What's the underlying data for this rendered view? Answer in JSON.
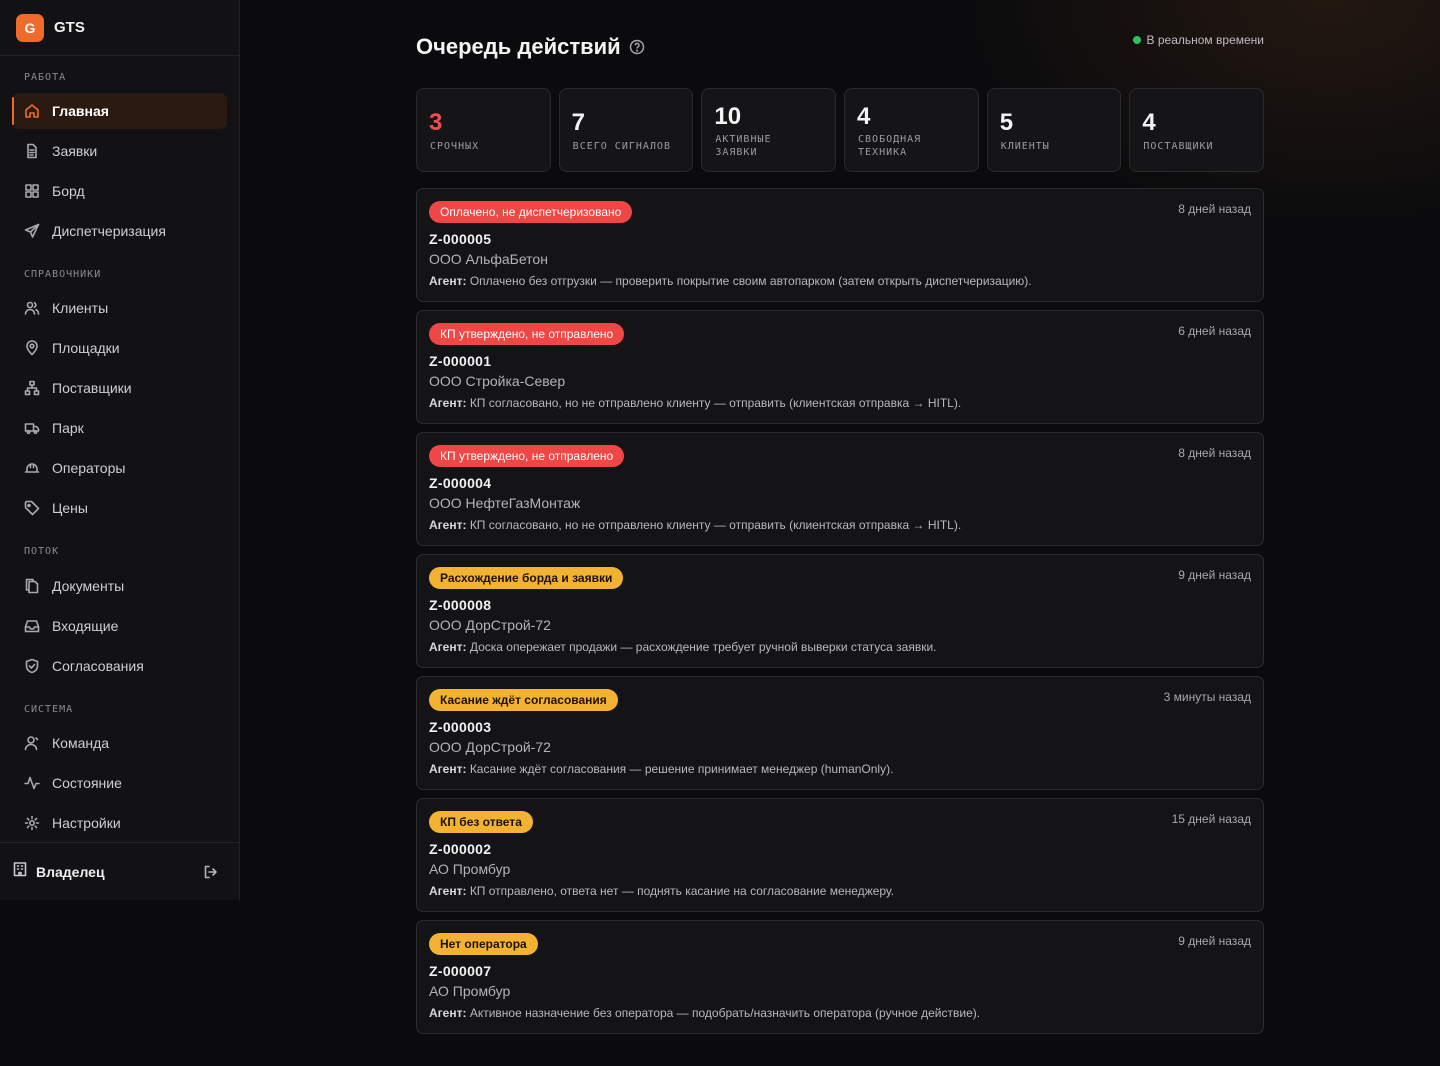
{
  "brand": {
    "logo_letter": "G",
    "name": "GTS"
  },
  "sidebar": {
    "sections": [
      {
        "title": "РАБОТА",
        "items": [
          {
            "label": "Главная",
            "icon": "home-icon",
            "active": true
          },
          {
            "label": "Заявки",
            "icon": "document-icon"
          },
          {
            "label": "Борд",
            "icon": "grid-icon"
          },
          {
            "label": "Диспетчеризация",
            "icon": "send-icon"
          }
        ]
      },
      {
        "title": "СПРАВОЧНИКИ",
        "items": [
          {
            "label": "Клиенты",
            "icon": "users-icon"
          },
          {
            "label": "Площадки",
            "icon": "map-pin-icon"
          },
          {
            "label": "Поставщики",
            "icon": "network-icon"
          },
          {
            "label": "Парк",
            "icon": "truck-icon"
          },
          {
            "label": "Операторы",
            "icon": "hard-hat-icon"
          },
          {
            "label": "Цены",
            "icon": "tag-icon"
          }
        ]
      },
      {
        "title": "ПОТОК",
        "items": [
          {
            "label": "Документы",
            "icon": "files-icon"
          },
          {
            "label": "Входящие",
            "icon": "inbox-icon"
          },
          {
            "label": "Согласования",
            "icon": "shield-check-icon"
          }
        ]
      },
      {
        "title": "СИСТЕМА",
        "items": [
          {
            "label": "Команда",
            "icon": "user-icon"
          },
          {
            "label": "Состояние",
            "icon": "activity-icon"
          },
          {
            "label": "Настройки",
            "icon": "gear-icon"
          }
        ]
      }
    ],
    "footer": {
      "user": "Владелец",
      "icon": "building-icon",
      "logout_icon": "logout-icon"
    }
  },
  "header": {
    "title": "Очередь действий",
    "live_label": "В реальном времени",
    "live_color": "#2fbf62"
  },
  "stats": [
    {
      "value": "3",
      "label": "СРОЧНЫХ",
      "urgent": true
    },
    {
      "value": "7",
      "label": "ВСЕГО СИГНАЛОВ"
    },
    {
      "value": "10",
      "label": "АКТИВНЫЕ ЗАЯВКИ"
    },
    {
      "value": "4",
      "label": "СВОБОДНАЯ ТЕХНИКА"
    },
    {
      "value": "5",
      "label": "КЛИЕНТЫ"
    },
    {
      "value": "4",
      "label": "ПОСТАВЩИКИ"
    }
  ],
  "agent_prefix": "Агент:",
  "cards": [
    {
      "badge": "Оплачено, не диспетчеризовано",
      "badge_color": "red",
      "time": "8 дней назад",
      "id": "Z-000005",
      "client": "ООО АльфаБетон",
      "agent": "Оплачено без отгрузки — проверить покрытие своим автопарком (затем открыть диспетчеризацию)."
    },
    {
      "badge": "КП утверждено, не отправлено",
      "badge_color": "red",
      "time": "6 дней назад",
      "id": "Z-000001",
      "client": "ООО Стройка-Север",
      "agent": "КП согласовано, но не отправлено клиенту — отправить (клиентская отправка → HITL)."
    },
    {
      "badge": "КП утверждено, не отправлено",
      "badge_color": "red",
      "time": "8 дней назад",
      "id": "Z-000004",
      "client": "ООО НефтеГазМонтаж",
      "agent": "КП согласовано, но не отправлено клиенту — отправить (клиентская отправка → HITL)."
    },
    {
      "badge": "Расхождение борда и заявки",
      "badge_color": "amber",
      "time": "9 дней назад",
      "id": "Z-000008",
      "client": "ООО ДорСтрой-72",
      "agent": "Доска опережает продажи — расхождение требует ручной выверки статуса заявки."
    },
    {
      "badge": "Касание ждёт согласования",
      "badge_color": "amber",
      "time": "3 минуты назад",
      "id": "Z-000003",
      "client": "ООО ДорСтрой-72",
      "agent": "Касание ждёт согласования — решение принимает менеджер (humanOnly)."
    },
    {
      "badge": "КП без ответа",
      "badge_color": "amber",
      "time": "15 дней назад",
      "id": "Z-000002",
      "client": "АО Промбур",
      "agent": "КП отправлено, ответа нет — поднять касание на согласование менеджеру."
    },
    {
      "badge": "Нет оператора",
      "badge_color": "amber",
      "time": "9 дней назад",
      "id": "Z-000007",
      "client": "АО Промбур",
      "agent": "Активное назначение без оператора — подобрать/назначить оператора (ручное действие)."
    }
  ],
  "colors": {
    "accent": "#f06a2c",
    "urgent": "#ef4646",
    "warning": "#f4b233"
  }
}
